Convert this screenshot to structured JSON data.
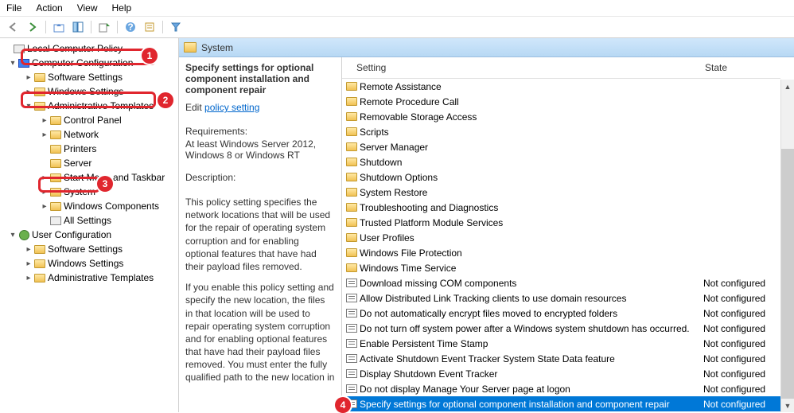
{
  "menu": {
    "file": "File",
    "action": "Action",
    "view": "View",
    "help": "Help"
  },
  "tree": {
    "root": "Local Computer Policy",
    "computer_config": "Computer Configuration",
    "software_settings": "Software Settings",
    "windows_settings": "Windows Settings",
    "admin_templates": "Administrative Templates",
    "control_panel": "Control Panel",
    "network": "Network",
    "printers": "Printers",
    "server": "Server",
    "start_taskbar": "Start Menu and Taskbar",
    "system": "System",
    "windows_components": "Windows Components",
    "all_settings": "All Settings",
    "user_config": "User Configuration",
    "u_software_settings": "Software Settings",
    "u_windows_settings": "Windows Settings",
    "u_admin_templates": "Administrative Templates"
  },
  "badges": {
    "b1": "1",
    "b2": "2",
    "b3": "3",
    "b4": "4"
  },
  "header": {
    "path": "System"
  },
  "columns": {
    "setting": "Setting",
    "state": "State"
  },
  "desc": {
    "title": "Specify settings for optional component installation and component repair",
    "edit_label": "Edit",
    "edit_link": "policy setting ",
    "req_label": "Requirements:",
    "req_text": "At least Windows Server 2012, Windows 8 or Windows RT",
    "desc_label": "Description:",
    "p1": "This policy setting specifies the network locations that will be used for the repair of operating system corruption and for enabling optional features that have had their payload files removed.",
    "p2": "If you enable this policy setting and specify the new location, the files in that location will be used to repair operating system corruption and for enabling optional features that have had their payload files removed. You must enter the fully qualified path to the new location in"
  },
  "settings": [
    {
      "type": "folder",
      "name": "Remote Assistance",
      "state": ""
    },
    {
      "type": "folder",
      "name": "Remote Procedure Call",
      "state": ""
    },
    {
      "type": "folder",
      "name": "Removable Storage Access",
      "state": ""
    },
    {
      "type": "folder",
      "name": "Scripts",
      "state": ""
    },
    {
      "type": "folder",
      "name": "Server Manager",
      "state": ""
    },
    {
      "type": "folder",
      "name": "Shutdown",
      "state": ""
    },
    {
      "type": "folder",
      "name": "Shutdown Options",
      "state": ""
    },
    {
      "type": "folder",
      "name": "System Restore",
      "state": ""
    },
    {
      "type": "folder",
      "name": "Troubleshooting and Diagnostics",
      "state": ""
    },
    {
      "type": "folder",
      "name": "Trusted Platform Module Services",
      "state": ""
    },
    {
      "type": "folder",
      "name": "User Profiles",
      "state": ""
    },
    {
      "type": "folder",
      "name": "Windows File Protection",
      "state": ""
    },
    {
      "type": "folder",
      "name": "Windows Time Service",
      "state": ""
    },
    {
      "type": "setting",
      "name": "Download missing COM components",
      "state": "Not configured"
    },
    {
      "type": "setting",
      "name": "Allow Distributed Link Tracking clients to use domain resources",
      "state": "Not configured"
    },
    {
      "type": "setting",
      "name": "Do not automatically encrypt files moved to encrypted folders",
      "state": "Not configured"
    },
    {
      "type": "setting",
      "name": "Do not turn off system power after a Windows system shutdown has occurred.",
      "state": "Not configured"
    },
    {
      "type": "setting",
      "name": "Enable Persistent Time Stamp",
      "state": "Not configured"
    },
    {
      "type": "setting",
      "name": "Activate Shutdown Event Tracker System State Data feature",
      "state": "Not configured"
    },
    {
      "type": "setting",
      "name": "Display Shutdown Event Tracker",
      "state": "Not configured"
    },
    {
      "type": "setting",
      "name": "Do not display Manage Your Server page at logon",
      "state": "Not configured"
    },
    {
      "type": "setting",
      "name": "Specify settings for optional component installation and component repair",
      "state": "Not configured",
      "selected": true
    }
  ]
}
